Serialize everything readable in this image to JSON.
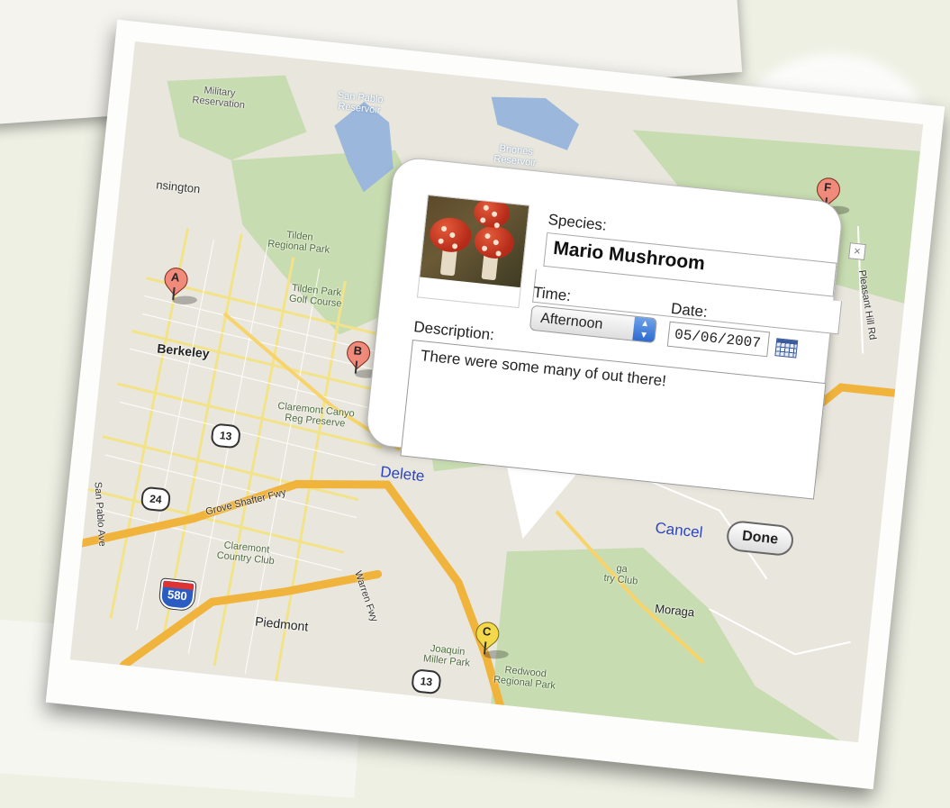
{
  "map": {
    "labels": {
      "military": "Military\nReservation",
      "san_pablo": "San Pablo\nReservoir",
      "briones": "Briones\nReservoir",
      "kensington": "nsington",
      "tilden": "Tilden\nRegional Park",
      "tilden_golf": "Tilden Park\nGolf Course",
      "berkeley": "Berkeley",
      "claremont_canyon": "Claremont Canyo\nReg Preserve",
      "grove_shafter": "Grove Shafter Fwy",
      "claremont_cc": "Claremont\nCountry Club",
      "san_pablo_ave": "San Pablo Ave",
      "piedmont": "Piedmont",
      "warren_fwy": "Warren Fwy",
      "joaquin_miller": "Joaquin\nMiller Park",
      "redwood": "Redwood\nRegional Park",
      "moraga": "Moraga",
      "pleasant_hill": "Pleasant Hill Rd",
      "country_club": "ga\ntry Club"
    },
    "shields": {
      "hwy13": "13",
      "hwy24": "24",
      "i580": "580",
      "hwy13b": "13"
    },
    "markers": {
      "a": "A",
      "b": "B",
      "c": "C",
      "f": "F"
    }
  },
  "info_window": {
    "species_label": "Species:",
    "species_value": "Mario Mushroom",
    "close_symbol": "×",
    "time_label": "Time:",
    "time_value": "Afternoon",
    "time_arrows": "▲\n▼",
    "date_label": "Date:",
    "date_value": "05/06/2007",
    "description_label": "Description:",
    "description_value": "There were some many of out there!",
    "delete_label": "Delete",
    "cancel_label": "Cancel",
    "done_label": "Done"
  }
}
